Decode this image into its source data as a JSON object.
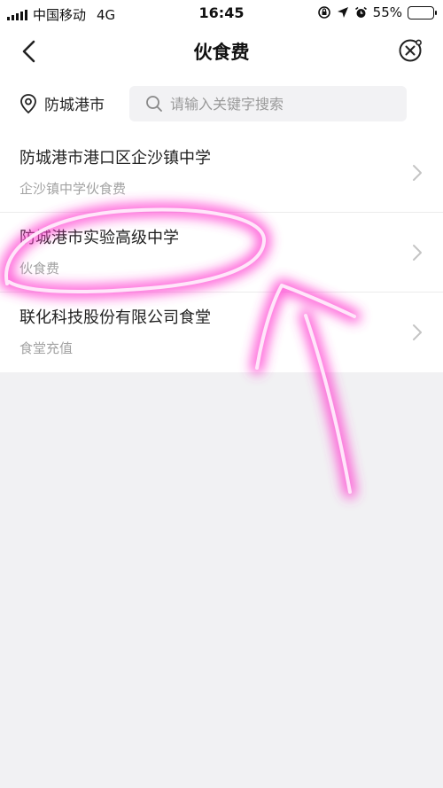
{
  "status_bar": {
    "carrier": "中国移动",
    "network": "4G",
    "time": "16:45",
    "battery": "55%",
    "battery_level": 0.55
  },
  "nav": {
    "title": "伙食费"
  },
  "search_row": {
    "location": "防城港市",
    "search_placeholder": "请输入关键字搜索"
  },
  "list": {
    "items": [
      {
        "title": "防城港市港口区企沙镇中学",
        "subtitle": "企沙镇中学伙食费"
      },
      {
        "title": "防城港市实验高级中学",
        "subtitle": "伙食费"
      },
      {
        "title": "联化科技股份有限公司食堂",
        "subtitle": "食堂充值"
      }
    ]
  },
  "colors": {
    "annotation": "#ff3fd0",
    "background": "#f1f1f3",
    "subtitle": "#a3a3a3"
  },
  "icons": [
    "signal-icon",
    "orientation-lock-icon",
    "location-arrow-icon",
    "alarm-icon",
    "battery-icon",
    "back-arrow-icon",
    "close-circle-icon",
    "location-pin-icon",
    "search-icon",
    "chevron-right-icon"
  ]
}
